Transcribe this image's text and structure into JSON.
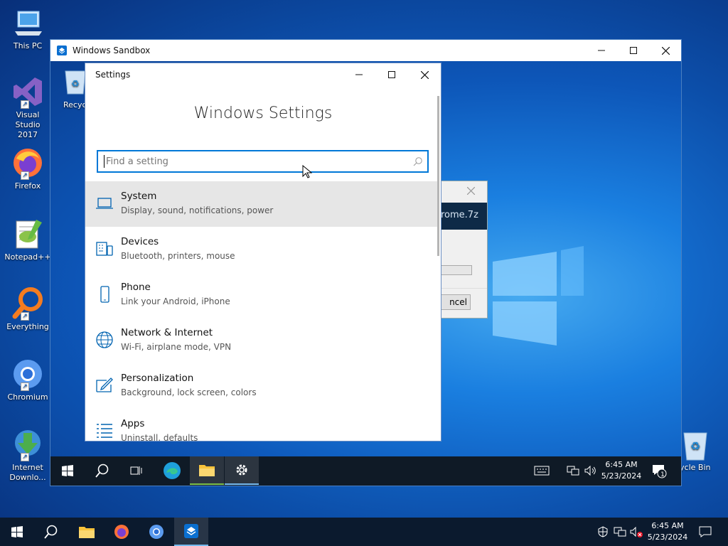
{
  "host_desktop": {
    "icons": [
      {
        "label": "This PC",
        "icon": "this-pc-icon"
      },
      {
        "label": "Visual Studio 2017",
        "icon": "visual-studio-icon"
      },
      {
        "label": "Firefox",
        "icon": "firefox-icon"
      },
      {
        "label": "Notepad++",
        "icon": "notepadpp-icon"
      },
      {
        "label": "Everything",
        "icon": "everything-icon"
      },
      {
        "label": "Chromium",
        "icon": "chromium-icon"
      },
      {
        "label": "Internet Downlo...",
        "icon": "internet-download-manager-icon"
      },
      {
        "label": "cycle Bin",
        "icon": "recycle-bin-icon"
      }
    ]
  },
  "host_taskbar": {
    "apps": [
      "start-icon",
      "search-icon",
      "file-explorer-icon",
      "firefox-icon",
      "chromium-icon",
      "windows-sandbox-icon"
    ],
    "time": "6:45 AM",
    "date": "5/23/2024"
  },
  "sandbox": {
    "title": "Windows Sandbox",
    "desktop": {
      "recycle_label": "Recycle",
      "bg_dialog": {
        "text": "rome.7z",
        "button": "ncel"
      }
    },
    "taskbar": {
      "time": "6:45 AM",
      "date": "5/23/2024",
      "notification_count": "1"
    }
  },
  "settings": {
    "window_title": "Settings",
    "heading": "Windows Settings",
    "search_placeholder": "Find a setting",
    "categories": [
      {
        "title": "System",
        "desc": "Display, sound, notifications, power",
        "icon": "laptop-icon"
      },
      {
        "title": "Devices",
        "desc": "Bluetooth, printers, mouse",
        "icon": "devices-icon"
      },
      {
        "title": "Phone",
        "desc": "Link your Android, iPhone",
        "icon": "phone-icon"
      },
      {
        "title": "Network & Internet",
        "desc": "Wi-Fi, airplane mode, VPN",
        "icon": "globe-icon"
      },
      {
        "title": "Personalization",
        "desc": "Background, lock screen, colors",
        "icon": "paint-icon"
      },
      {
        "title": "Apps",
        "desc": "Uninstall, defaults",
        "icon": "apps-list-icon"
      }
    ]
  }
}
